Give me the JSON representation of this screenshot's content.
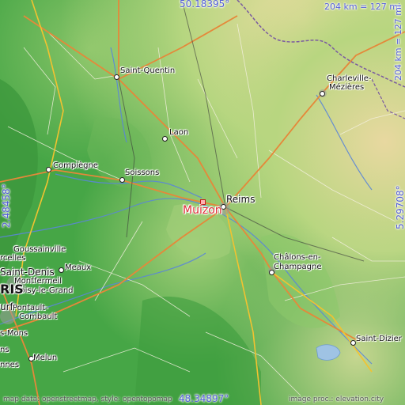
{
  "map": {
    "place_name": "Muizon",
    "coords": {
      "top_lat": "50.18395°",
      "bottom_lat": "48.34897°",
      "left_lon": "2.48458°",
      "right_lon": "5.29708°"
    },
    "scale": {
      "top": "204 km = 127 mi",
      "right": "204 km = 127 mi"
    },
    "attribution": {
      "left": "map data: openstreetmap, style: opentopomap",
      "right": "image proc.: elevation.city"
    },
    "cities": {
      "saint_quentin": "Saint-Quentin",
      "charleville": "Charleville-",
      "charleville2": "Mézières",
      "laon": "Laon",
      "compiegne": "Compiègne",
      "soissons": "Soissons",
      "reims": "Reims",
      "chalons1": "Châlons-en-",
      "chalons2": "Champagne",
      "goussainville": "Goussainville",
      "celles": "rcelles",
      "st_denis": "Saint-Denis",
      "montfermeil": "Montfermeil",
      "meaux": "Meaux",
      "noisy": "Noisy-le-Grand",
      "ris": "RIS",
      "urf": "urf",
      "pontault1": "Pontault-",
      "pontault2": "Combault",
      "mons": "s-Mons",
      "melun": "Melun",
      "saint_dizier": "Saint-Dizier",
      "ns": "ns",
      "nnes": "nnes"
    }
  }
}
